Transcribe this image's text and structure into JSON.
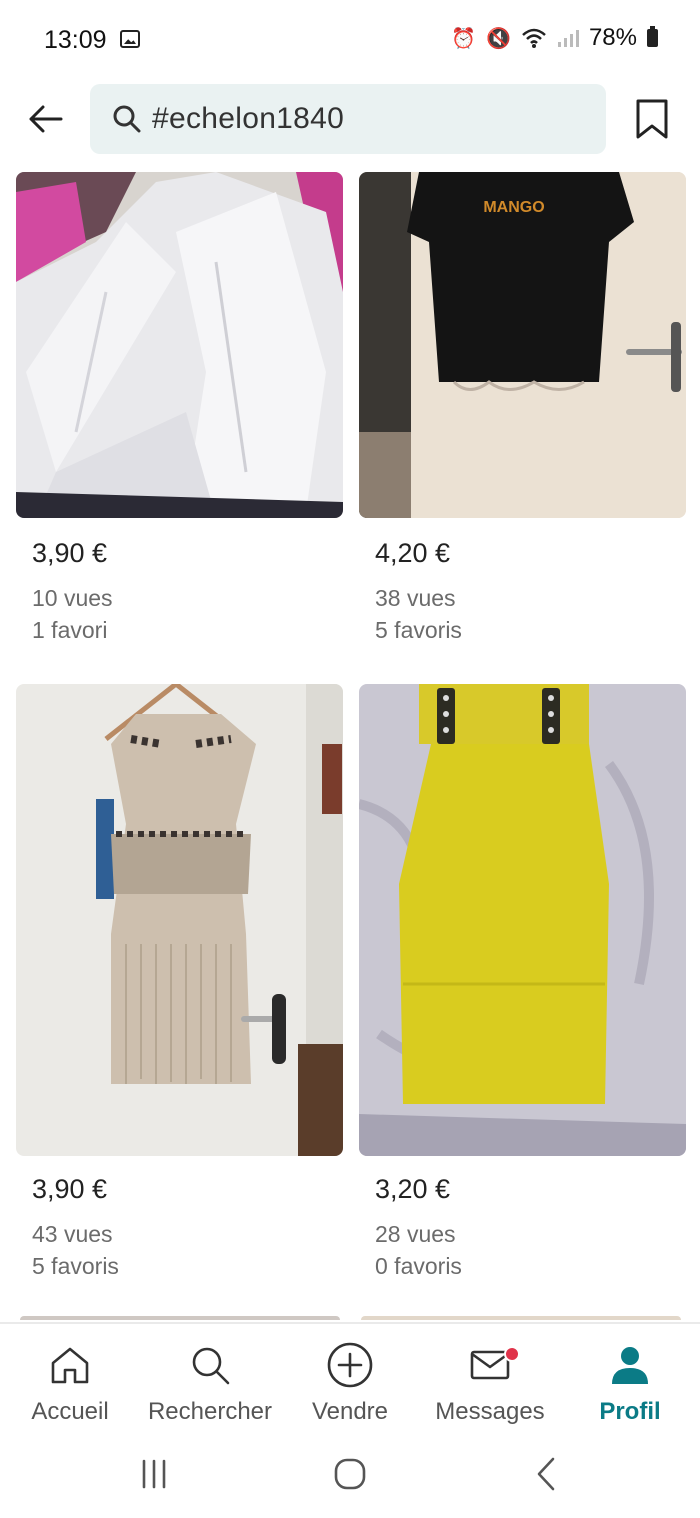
{
  "status_bar": {
    "time": "13:09",
    "battery": "78%"
  },
  "header": {
    "search_value": "#echelon1840"
  },
  "items": [
    {
      "price": "3,90 €",
      "views": "10 vues",
      "favorites": "1 favori"
    },
    {
      "price": "4,20 €",
      "views": "38 vues",
      "favorites": "5 favoris",
      "brand_print": "MANGO"
    },
    {
      "price": "3,90 €",
      "views": "43 vues",
      "favorites": "5 favoris"
    },
    {
      "price": "3,20 €",
      "views": "28 vues",
      "favorites": "0 favoris"
    }
  ],
  "bottom_nav": [
    {
      "label": "Accueil",
      "icon": "home-icon"
    },
    {
      "label": "Rechercher",
      "icon": "search-icon"
    },
    {
      "label": "Vendre",
      "icon": "plus-circle-icon"
    },
    {
      "label": "Messages",
      "icon": "mail-icon"
    },
    {
      "label": "Profil",
      "icon": "profile-icon",
      "active": true
    }
  ],
  "colors": {
    "accent": "#0b7b86",
    "search_bg": "#eaf2f2",
    "notification_dot": "#e0334a"
  }
}
